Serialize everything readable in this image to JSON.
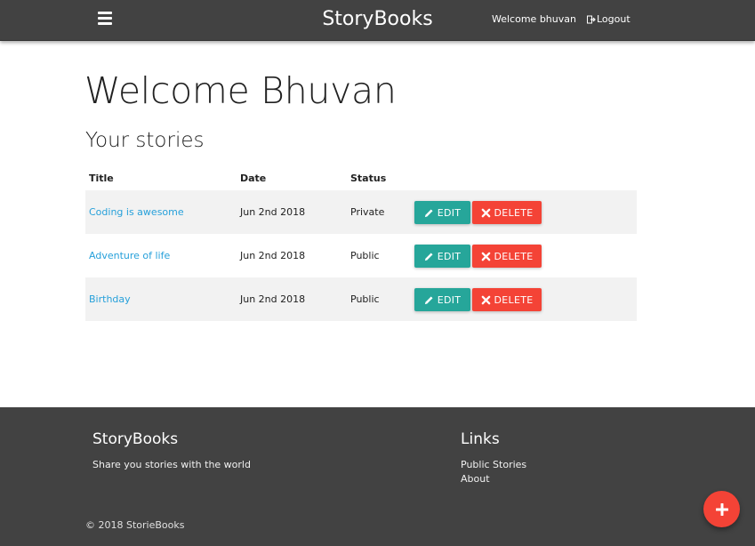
{
  "nav": {
    "brand": "StoryBooks",
    "welcome": "Welcome bhuvan",
    "logout": "Logout",
    "menu_icon": "hamburger-menu-icon",
    "logout_icon": "sign-out-icon"
  },
  "main": {
    "heading": "Welcome Bhuvan",
    "subheading": "Your stories",
    "table": {
      "columns": [
        "Title",
        "Date",
        "Status"
      ],
      "rows": [
        {
          "title": "Coding is awesome",
          "date": "Jun 2nd 2018",
          "status": "Private"
        },
        {
          "title": "Adventure of life",
          "date": "Jun 2nd 2018",
          "status": "Public"
        },
        {
          "title": "Birthday",
          "date": "Jun 2nd 2018",
          "status": "Public"
        }
      ],
      "edit_label": "EDIT",
      "delete_label": "DELETE"
    }
  },
  "footer": {
    "brand": "StoryBooks",
    "tagline": "Share you stories with the world",
    "links_title": "Links",
    "links": [
      "Public Stories",
      "About"
    ],
    "copyright": "© 2018 StorieBooks"
  },
  "colors": {
    "navbar": "#424242",
    "edit": "#26a69a",
    "delete": "#f44336",
    "link": "#26a0da",
    "fab": "#f44336"
  },
  "fab": {
    "icon": "plus-icon"
  }
}
